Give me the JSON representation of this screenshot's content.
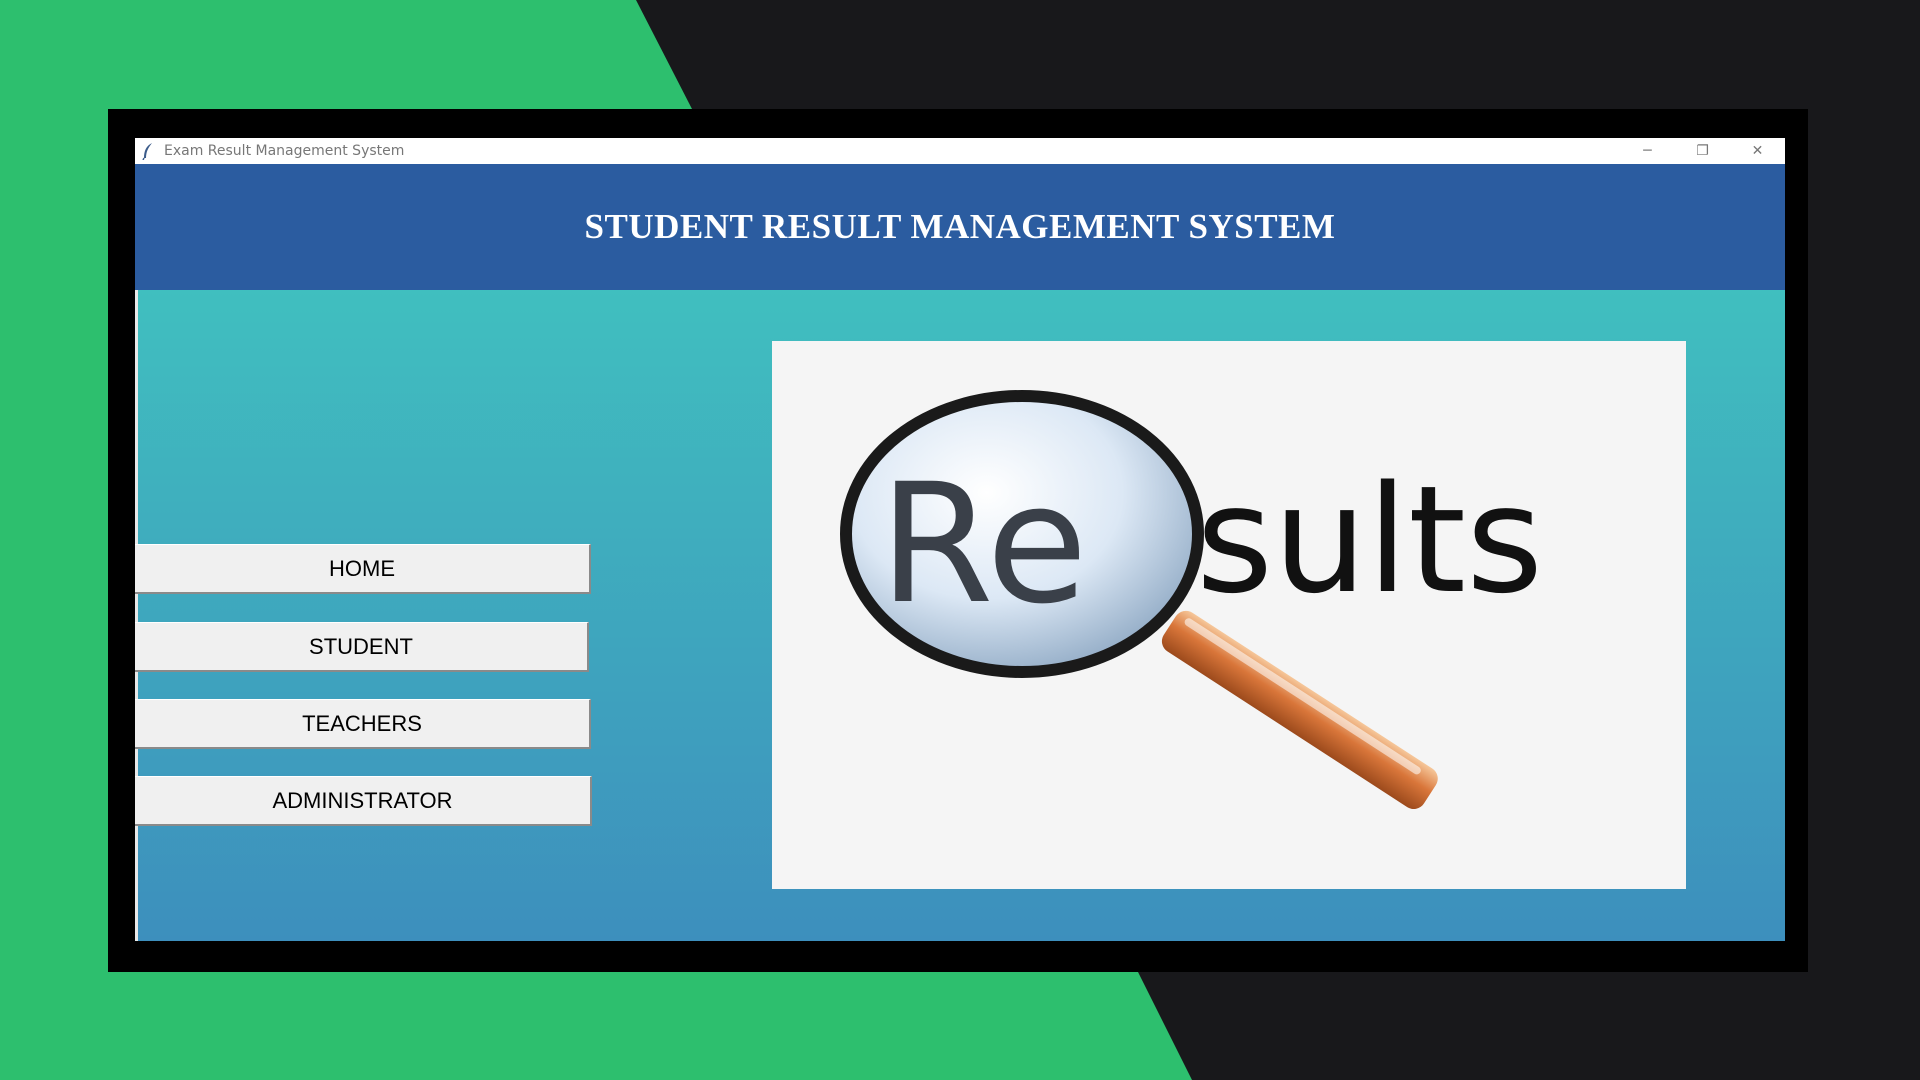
{
  "window": {
    "title": "Exam Result Management System",
    "controls": {
      "minimize": "─",
      "restore": "❐",
      "close": "✕"
    }
  },
  "header": {
    "title": "STUDENT RESULT MANAGEMENT SYSTEM"
  },
  "nav": {
    "items": [
      {
        "label": "HOME"
      },
      {
        "label": "STUDENT"
      },
      {
        "label": "TEACHERS"
      },
      {
        "label": "ADMINISTRATOR"
      }
    ]
  },
  "image": {
    "icon": "magnifying-glass-icon",
    "text_left": "Re",
    "text_right": "sults"
  },
  "colors": {
    "header": "#2b5ca0",
    "gradient_top": "#40bfbf",
    "gradient_bottom": "#3d8fbd",
    "background_green": "#2dbf6e",
    "background_dark": "#18181b"
  }
}
